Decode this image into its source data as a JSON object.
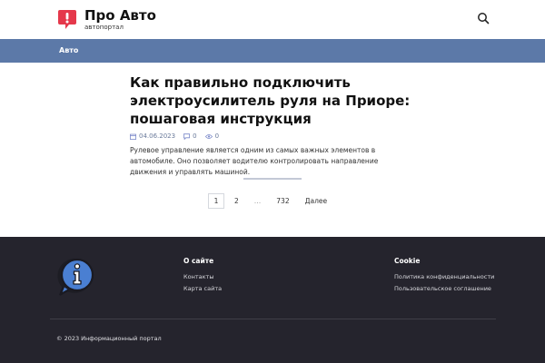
{
  "header": {
    "title": "Про Авто",
    "subtitle": "автопортал",
    "logo_icon": "alert-bubble-icon",
    "search_icon": "search-icon",
    "accent": "#e5384b"
  },
  "nav": {
    "background": "#5c79a8",
    "items": [
      {
        "label": "Авто"
      }
    ]
  },
  "article": {
    "title": "Как правильно подключить электроусилитель руля на Приоре: пошаговая инструкция",
    "date": "04.06.2023",
    "comments": "0",
    "views": "0",
    "excerpt": "Рулевое управление является одним из самых важных элементов в автомобиле. Оно позволяет водителю контролировать направление движения и управлять машиной."
  },
  "pagination": {
    "current": "1",
    "pages": [
      "2"
    ],
    "ellipsis": "…",
    "last": "732",
    "next_label": "Далее"
  },
  "footer": {
    "logo_icon": "info-bubble-icon",
    "col1": {
      "title": "О сайте",
      "links": [
        "Контакты",
        "Карта сайта"
      ]
    },
    "col2": {
      "title": "Cookie",
      "links": [
        "Политика конфиденциальности",
        "Пользовательское соглашение"
      ]
    },
    "copyright": "© 2023 Информационный портал",
    "background": "#25242d"
  }
}
